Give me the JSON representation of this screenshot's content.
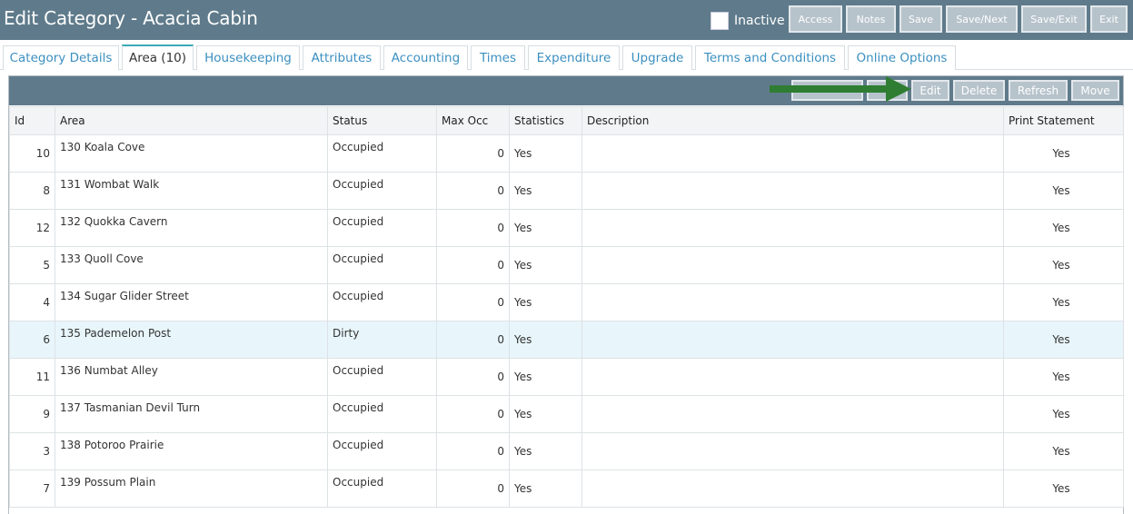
{
  "header": {
    "title": "Edit Category - Acacia Cabin",
    "inactive_label": "Inactive",
    "buttons": [
      "Access",
      "Notes",
      "Save",
      "Save/Next",
      "Save/Exit",
      "Exit"
    ]
  },
  "tabs": [
    {
      "label": "Category Details"
    },
    {
      "label": "Area (10)"
    },
    {
      "label": "Housekeeping"
    },
    {
      "label": "Attributes"
    },
    {
      "label": "Accounting"
    },
    {
      "label": "Times"
    },
    {
      "label": "Expenditure"
    },
    {
      "label": "Upgrade"
    },
    {
      "label": "Terms and Conditions"
    },
    {
      "label": "Online Options"
    }
  ],
  "active_tab": "Area (10)",
  "toolbar": {
    "buttons": [
      "",
      "",
      "Edit",
      "Delete",
      "Refresh",
      "Move"
    ]
  },
  "colors": {
    "header_bg": "#5f7b8b",
    "tab_text": "#3b8fc0",
    "arrow": "#2e7d32",
    "selected_row": "#e8f6fb"
  },
  "table": {
    "headers": [
      "Id",
      "Area",
      "Status",
      "Max Occ",
      "Statistics",
      "Description",
      "Print Statement"
    ],
    "rows": [
      [
        "10",
        "130 Koala Cove",
        "Occupied",
        "0",
        "Yes",
        "",
        "Yes"
      ],
      [
        "8",
        "131 Wombat Walk",
        "Occupied",
        "0",
        "Yes",
        "",
        "Yes"
      ],
      [
        "12",
        "132 Quokka Cavern",
        "Occupied",
        "0",
        "Yes",
        "",
        "Yes"
      ],
      [
        "5",
        "133 Quoll Cove",
        "Occupied",
        "0",
        "Yes",
        "",
        "Yes"
      ],
      [
        "4",
        "134 Sugar Glider Street",
        "Occupied",
        "0",
        "Yes",
        "",
        "Yes"
      ],
      [
        "6",
        "135 Pademelon Post",
        "Dirty",
        "0",
        "Yes",
        "",
        "Yes"
      ],
      [
        "11",
        "136 Numbat Alley",
        "Occupied",
        "0",
        "Yes",
        "",
        "Yes"
      ],
      [
        "9",
        "137 Tasmanian Devil Turn",
        "Occupied",
        "0",
        "Yes",
        "",
        "Yes"
      ],
      [
        "3",
        "138 Potoroo Prairie",
        "Occupied",
        "0",
        "Yes",
        "",
        "Yes"
      ],
      [
        "7",
        "139 Possum Plain",
        "Occupied",
        "0",
        "Yes",
        "",
        "Yes"
      ]
    ],
    "selected_row_id": "6"
  }
}
